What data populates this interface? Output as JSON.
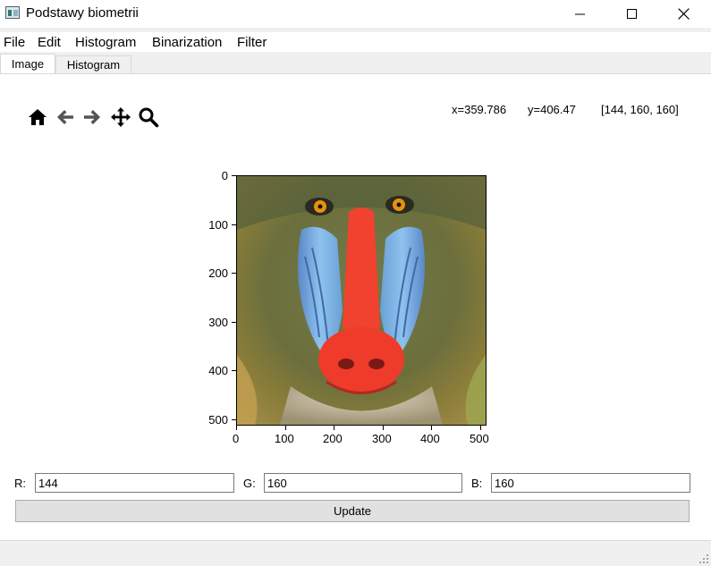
{
  "window": {
    "title": "Podstawy biometrii"
  },
  "menu": [
    "File",
    "Edit",
    "Histogram",
    "Binarization",
    "Filter"
  ],
  "tabs": {
    "image": "Image",
    "histogram": "Histogram"
  },
  "toolbar": {
    "icons": [
      "home-icon",
      "back-arrow-icon",
      "forward-arrow-icon",
      "pan-move-icon",
      "zoom-magnifier-icon"
    ],
    "x_readout": "x=359.786",
    "y_readout": "y=406.47",
    "pixel_readout": "[144, 160, 160]"
  },
  "plot": {
    "y_ticks": [
      "0",
      "100",
      "200",
      "300",
      "400",
      "500"
    ],
    "x_ticks": [
      "0",
      "100",
      "200",
      "300",
      "400",
      "500"
    ],
    "image_subject": "mandrill"
  },
  "rgb": {
    "r_label": "R:",
    "r_value": "144",
    "g_label": "G:",
    "g_value": "160",
    "b_label": "B:",
    "b_value": "160"
  },
  "update_label": "Update",
  "colors": {
    "tab_active": "#ffffff",
    "pane_bg": "#ffffff",
    "window_bg": "#f0f0f0",
    "button_bg": "#e1e1e1"
  }
}
